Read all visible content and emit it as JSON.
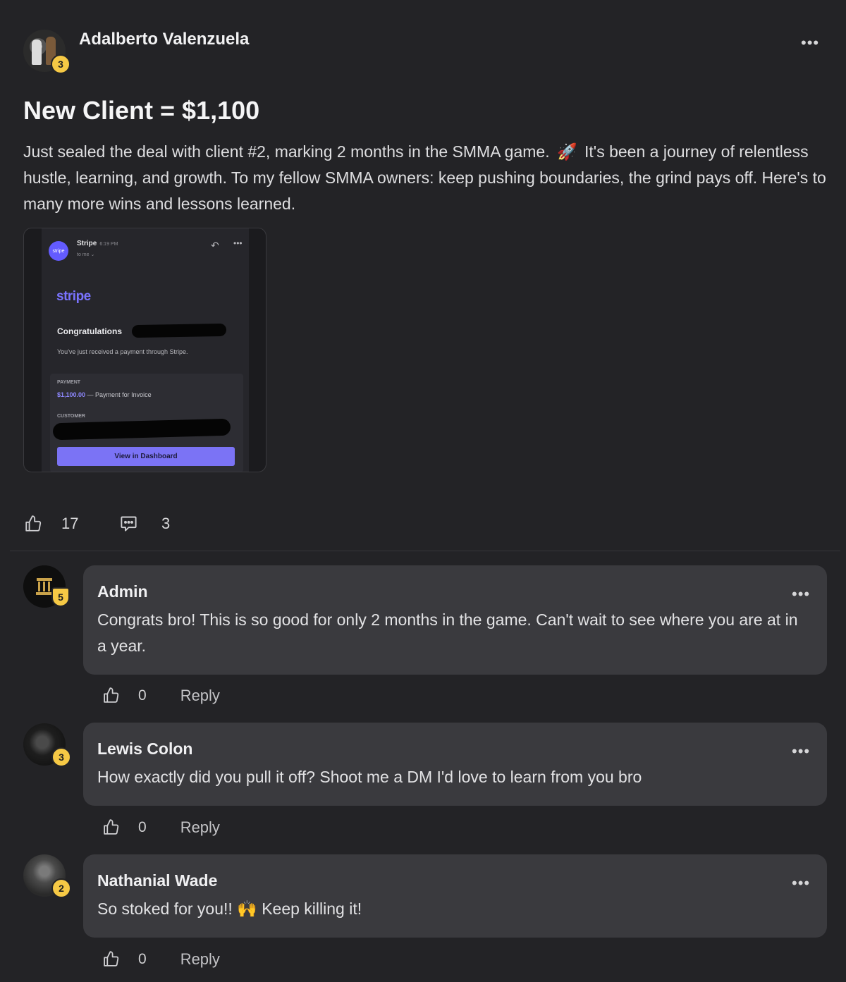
{
  "post": {
    "author": {
      "name": "Adalberto Valenzuela",
      "level": "3"
    },
    "title": "New Client = $1,100",
    "body_part1": "Just sealed the deal with client #2, marking 2 months in the SMMA game.",
    "body_emoji": "🚀",
    "body_part2": "It's been a journey of relentless hustle, learning, and growth. To my fellow SMMA owners: keep pushing boundaries, the grind pays off. Here's to many more wins and lessons learned.",
    "likes": "17",
    "comments": "3",
    "attachment": {
      "avatar_text": "stripe",
      "sender": "Stripe",
      "time": "6:19 PM",
      "to": "to me ⌄",
      "logo": "stripe",
      "congrats": "Congratulations",
      "received": "You've just received a payment through Stripe.",
      "payment_label": "PAYMENT",
      "payment_amount": "$1,100.00",
      "payment_desc": " — Payment for Invoice",
      "customer_label": "CUSTOMER",
      "button": "View in Dashboard"
    }
  },
  "comments": [
    {
      "author": "Admin",
      "level": "5",
      "text": "Congrats bro! This is so good for only 2 months in the game. Can't wait to see where you are at in a year.",
      "likes": "0",
      "reply": "Reply"
    },
    {
      "author": "Lewis Colon",
      "level": "3",
      "text": "How exactly did you pull it off? Shoot me a DM I'd love to learn from you bro",
      "likes": "0",
      "reply": "Reply"
    },
    {
      "author": "Nathanial Wade",
      "level": "2",
      "text_part1": "So stoked for you!!",
      "emoji": "🙌",
      "text_part2": "Keep killing it!",
      "likes": "0",
      "reply": "Reply"
    }
  ],
  "icons": {
    "more": "more-horizontal-icon",
    "like": "thumbs-up-icon",
    "comment": "comment-bubble-icon"
  },
  "colors": {
    "background": "#232326",
    "bubble": "#3a3a3e",
    "level_badge": "#f6c945",
    "stripe_accent": "#635bff"
  }
}
